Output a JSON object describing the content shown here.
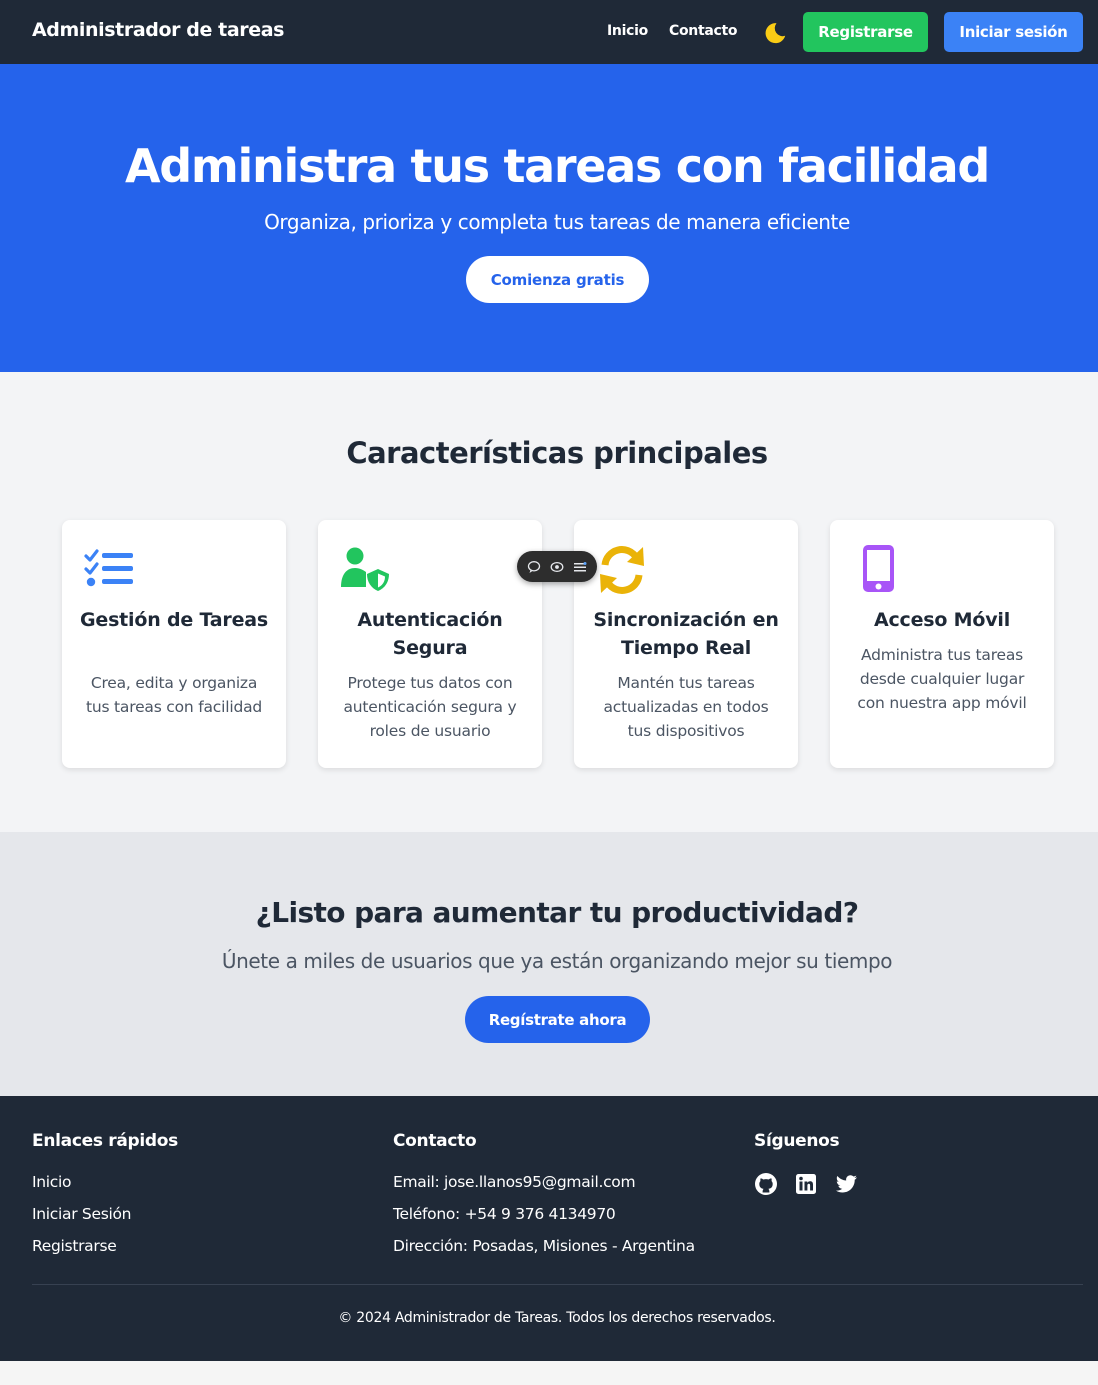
{
  "navbar": {
    "brand": "Administrador de tareas",
    "links": [
      "Inicio",
      "Contacto"
    ],
    "theme_icon": "moon-icon",
    "register_label": "Registrarse",
    "login_label": "Iniciar sesión"
  },
  "hero": {
    "title": "Administra tus tareas con facilidad",
    "subtitle": "Organiza, prioriza y completa tus tareas de manera eficiente",
    "cta_label": "Comienza gratis"
  },
  "features": {
    "title": "Características principales",
    "cards": [
      {
        "icon": "task-list-icon",
        "title": "Gestión de Tareas",
        "description": "Crea, edita y organiza tus tareas con facilidad",
        "color": "#3b82f6"
      },
      {
        "icon": "user-shield-icon",
        "title": "Autenticación Segura",
        "description": "Protege tus datos con autenticación segura y roles de usuario",
        "color": "#22c55e"
      },
      {
        "icon": "sync-icon",
        "title": "Sincronización en Tiempo Real",
        "description": "Mantén tus tareas actualizadas en todos tus dispositivos",
        "color": "#eab308"
      },
      {
        "icon": "mobile-icon",
        "title": "Acceso Móvil",
        "description": "Administra tus tareas desde cualquier lugar con nuestra app móvil",
        "color": "#a855f7"
      }
    ]
  },
  "floating_toolbar": {
    "icons": [
      "comment-icon",
      "view-icon",
      "list-icon"
    ]
  },
  "cta": {
    "title": "¿Listo para aumentar tu productividad?",
    "subtitle": "Únete a miles de usuarios que ya están organizando mejor su tiempo",
    "button_label": "Regístrate ahora"
  },
  "footer": {
    "quick_links_title": "Enlaces rápidos",
    "quick_links": [
      "Inicio",
      "Iniciar Sesión",
      "Registrarse"
    ],
    "contact_title": "Contacto",
    "contact": {
      "email": "Email: jose.llanos95@gmail.com",
      "phone": "Teléfono: +54 9 376 4134970",
      "address": "Dirección: Posadas, Misiones - Argentina"
    },
    "social_title": "Síguenos",
    "social_icons": [
      "github-icon",
      "linkedin-icon",
      "twitter-icon"
    ],
    "copyright": "© 2024 Administrador de Tareas. Todos los derechos reservados."
  },
  "colors": {
    "navbar_bg": "#1f2937",
    "hero_bg": "#2563eb",
    "register_green": "#22c55e",
    "login_blue": "#3b82f6",
    "moon_yellow": "#facc15"
  }
}
